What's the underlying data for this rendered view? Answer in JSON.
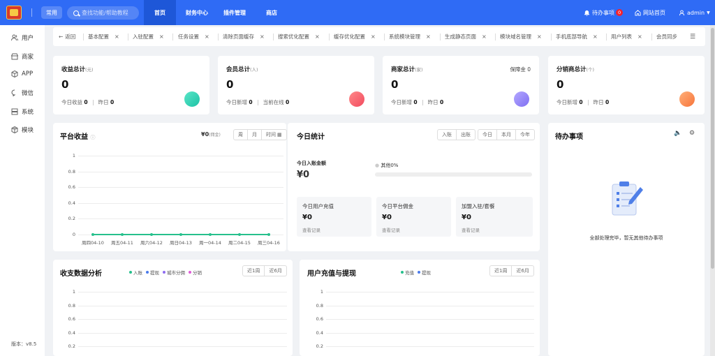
{
  "topbar": {
    "common_label": "常用",
    "search_placeholder": "查找功能/帮助教程",
    "nav": [
      "首页",
      "财务中心",
      "插件管理",
      "商店"
    ],
    "todo_label": "待办事项",
    "todo_count": "0",
    "site_home": "网站首页",
    "user": "admin"
  },
  "sidebar": {
    "items": [
      {
        "label": "用户",
        "icon": "user-icon"
      },
      {
        "label": "商家",
        "icon": "shop-icon"
      },
      {
        "label": "APP",
        "icon": "cube-icon"
      },
      {
        "label": "微信",
        "icon": "chat-icon"
      },
      {
        "label": "系统",
        "icon": "server-icon"
      },
      {
        "label": "模块",
        "icon": "package-icon"
      }
    ],
    "version": "版本：v8.5"
  },
  "tabs": {
    "back_label": "返回",
    "items": [
      "基本配置",
      "入驻配置",
      "任务设置",
      "清除页面缓存",
      "搜索优化配置",
      "缓存优化配置",
      "系统模块管理",
      "生成静态页面",
      "模块域名管理",
      "手机底部导航",
      "用户列表",
      "会员同步"
    ]
  },
  "stats": [
    {
      "title": "收益总计",
      "unit": "(元)",
      "value": "0",
      "sub1_label": "今日收益",
      "sub1_value": "0",
      "sub2_label": "昨日",
      "sub2_value": "0",
      "extra": "",
      "icon_color": "#2ed1b6"
    },
    {
      "title": "会员总计",
      "unit": "(人)",
      "value": "0",
      "sub1_label": "今日新增",
      "sub1_value": "0",
      "sub2_label": "当前在线",
      "sub2_value": "0",
      "extra": "",
      "icon_color": "#f5566a"
    },
    {
      "title": "商家总计",
      "unit": "(家)",
      "value": "0",
      "sub1_label": "今日新增",
      "sub1_value": "0",
      "sub2_label": "昨日",
      "sub2_value": "0",
      "extra": "保障金 0",
      "icon_color": "#8b7cf6"
    },
    {
      "title": "分销商总计",
      "unit": "(个)",
      "value": "0",
      "sub1_label": "今日新增",
      "sub1_value": "0",
      "sub2_label": "昨日",
      "sub2_value": "0",
      "extra": "",
      "icon_color": "#fb8a4a"
    }
  ],
  "platform": {
    "title": "平台收益",
    "amount": "¥0",
    "amount_note": "(佣金)",
    "btns": [
      "周",
      "月",
      "时间"
    ]
  },
  "today": {
    "title": "今日统计",
    "btns1": [
      "入账",
      "出账"
    ],
    "btns2": [
      "今日",
      "本月",
      "今年"
    ],
    "income_label": "今日入账金额",
    "income_value": "¥0",
    "progress_label": "其他0%",
    "progress": 0,
    "minis": [
      {
        "title": "今日用户充值",
        "value": "¥0",
        "link": "查看记录"
      },
      {
        "title": "今日平台佣金",
        "value": "¥0",
        "link": "查看记录"
      },
      {
        "title": "加盟入驻/套餐",
        "value": "¥0",
        "link": "查看记录"
      }
    ]
  },
  "todo_panel": {
    "title": "待办事项",
    "empty_text": "全部处理完毕，暂无其他待办事项"
  },
  "income_chart": {
    "title": "收支数据分析",
    "legend": [
      {
        "name": "入账",
        "color": "#26c08c"
      },
      {
        "name": "提现",
        "color": "#4b7bec"
      },
      {
        "name": "城市分佣",
        "color": "#8e6cf0"
      },
      {
        "name": "分销",
        "color": "#e05ad8"
      }
    ],
    "btns": [
      "近1周",
      "近6月"
    ]
  },
  "recharge_chart": {
    "title": "用户充值与提现",
    "legend": [
      {
        "name": "充值",
        "color": "#26c08c"
      },
      {
        "name": "提现",
        "color": "#4b7bec"
      }
    ],
    "btns": [
      "近1周",
      "近6月"
    ]
  },
  "chart_data": [
    {
      "type": "line",
      "title": "平台收益",
      "categories": [
        "周四04-10",
        "周五04-11",
        "周六04-12",
        "周日04-13",
        "周一04-14",
        "周二04-15",
        "周三04-16"
      ],
      "values": [
        0,
        0,
        0,
        0,
        0,
        0,
        0
      ],
      "yticks": [
        "1",
        "0.8",
        "0.6",
        "0.4",
        "0.2",
        "0"
      ],
      "ylim": [
        0,
        1
      ],
      "color": "#26c08c"
    },
    {
      "type": "line",
      "title": "收支数据分析",
      "yticks": [
        "1",
        "0.8",
        "0.6",
        "0.4",
        "0.2"
      ],
      "ylim": [
        0,
        1
      ]
    },
    {
      "type": "line",
      "title": "用户充值与提现",
      "yticks": [
        "1",
        "0.8",
        "0.6",
        "0.4",
        "0.2"
      ],
      "ylim": [
        0,
        1
      ]
    }
  ]
}
